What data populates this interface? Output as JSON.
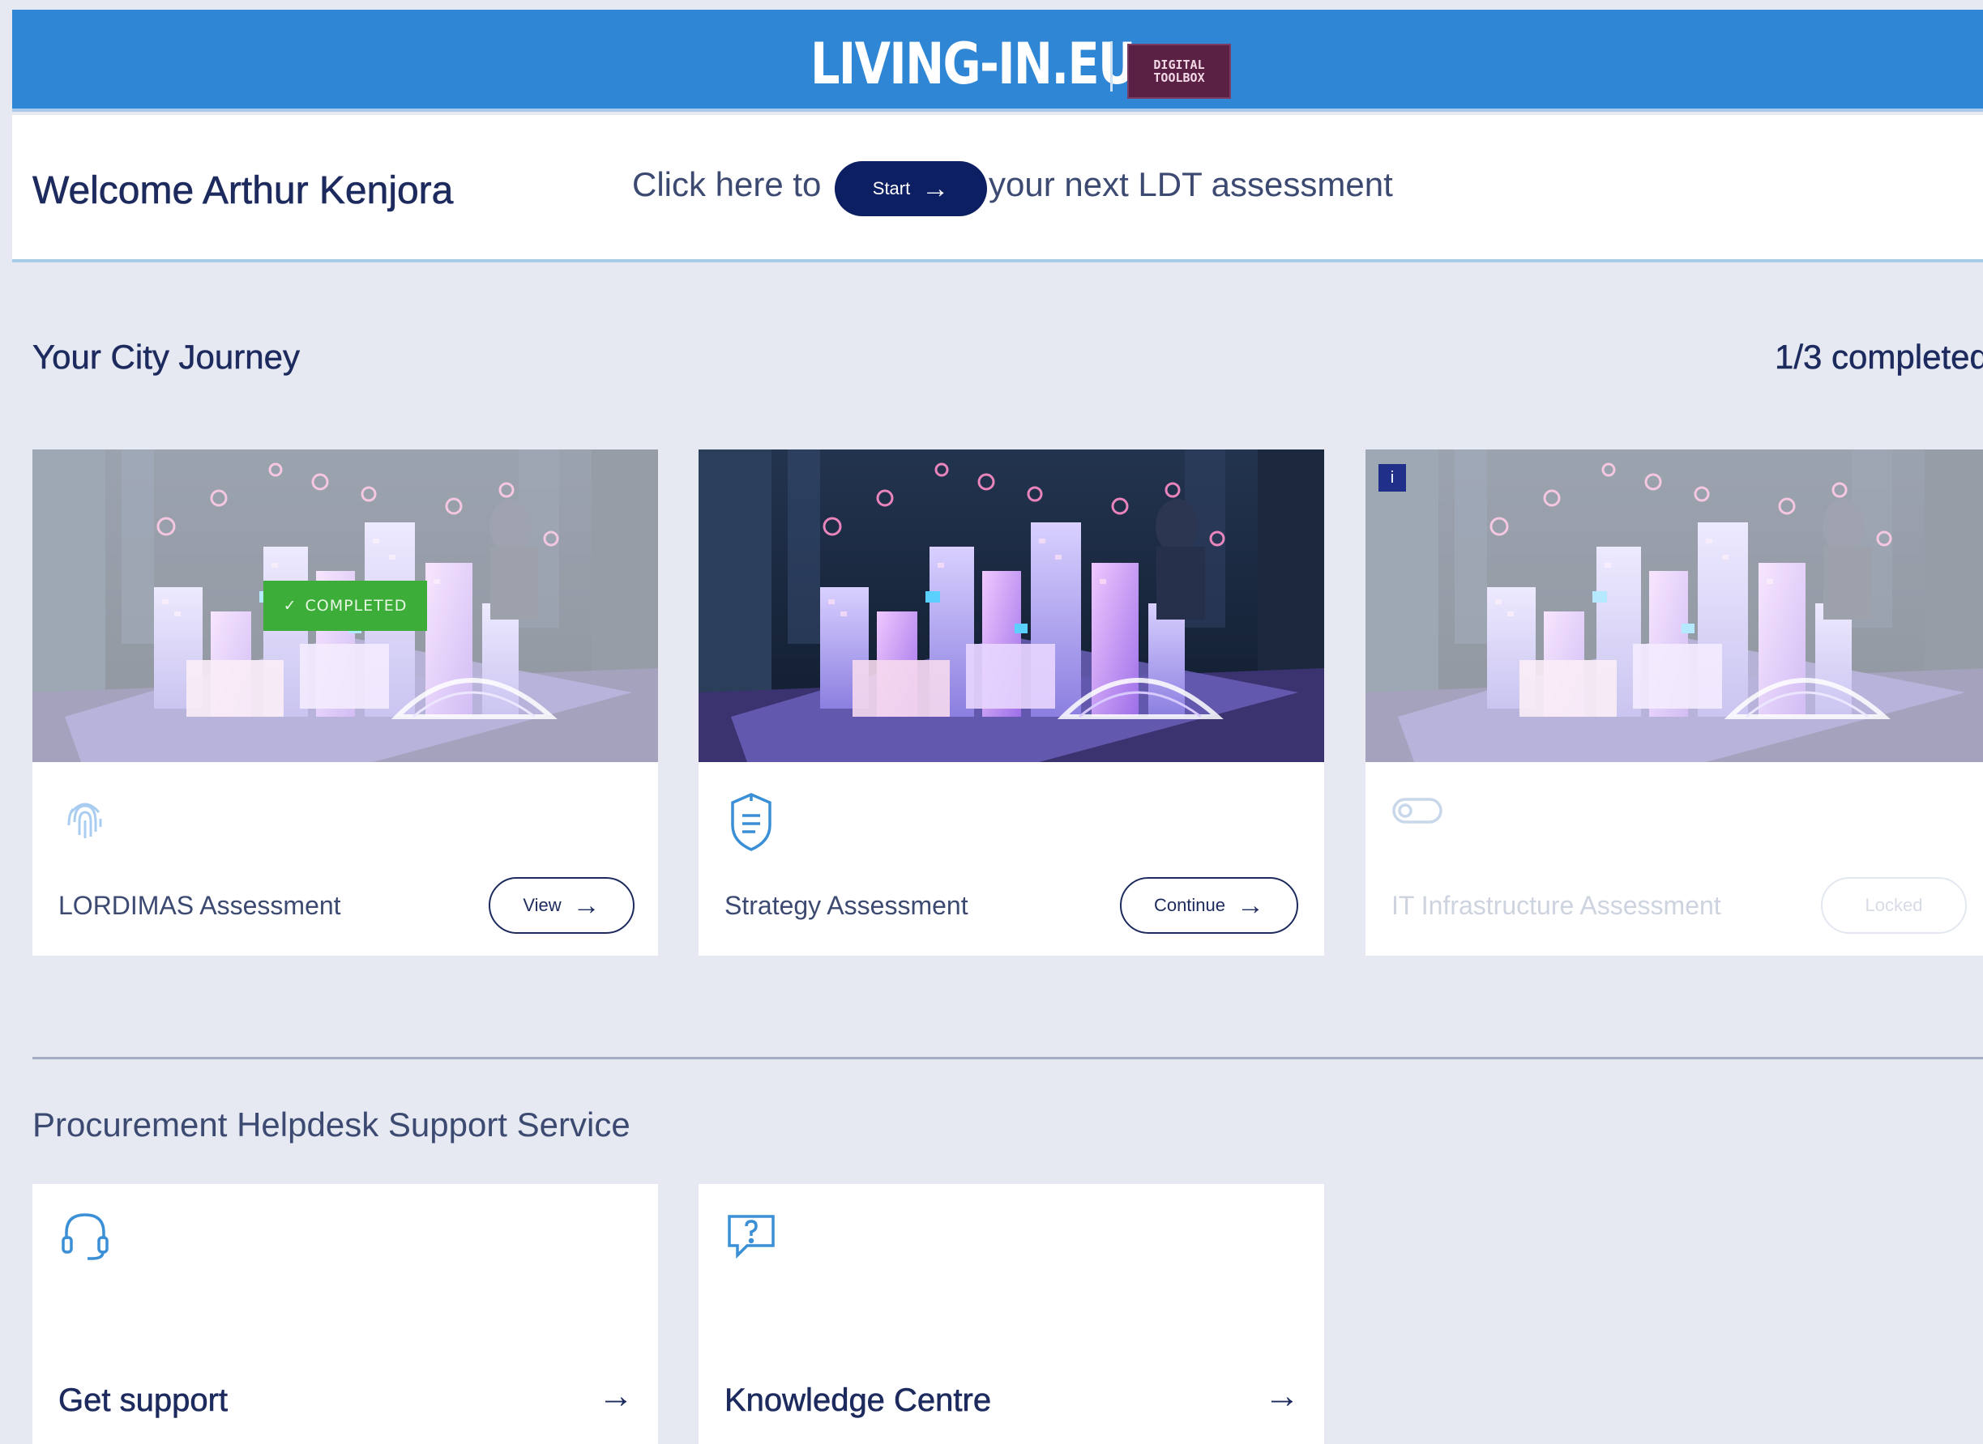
{
  "header": {
    "logo_text": "LIVING-IN.EU",
    "badge_line1": "DIGITAL",
    "badge_line2": "TOOLBOX"
  },
  "welcome": {
    "title": "Welcome Arthur Kenjora",
    "cta_prefix": "Click here to",
    "start_label": "Start",
    "cta_suffix": "your next LDT assessment"
  },
  "journey": {
    "title": "Your City Journey",
    "progress": "1/3 completed",
    "cards": [
      {
        "title": "LORDIMAS Assessment",
        "button": "View",
        "status": "COMPLETED",
        "icon": "fingerprint-icon"
      },
      {
        "title": "Strategy Assessment",
        "button": "Continue",
        "icon": "shield-document-icon"
      },
      {
        "title": "IT Infrastructure Assessment",
        "button": "Locked",
        "info": "i",
        "icon": "toggle-icon"
      }
    ]
  },
  "helpdesk": {
    "title": "Procurement Helpdesk Support Service",
    "cards": [
      {
        "title": "Get support",
        "icon": "headset-icon"
      },
      {
        "title": "Knowledge Centre",
        "icon": "question-bubble-icon"
      }
    ]
  },
  "colors": {
    "header_blue": "#2f86d4",
    "navy": "#1c2a5e",
    "start_button": "#0d1f63",
    "completed_green": "#3cad38",
    "page_bg": "#e6e9f2",
    "icon_blue": "#3a8fd6"
  }
}
